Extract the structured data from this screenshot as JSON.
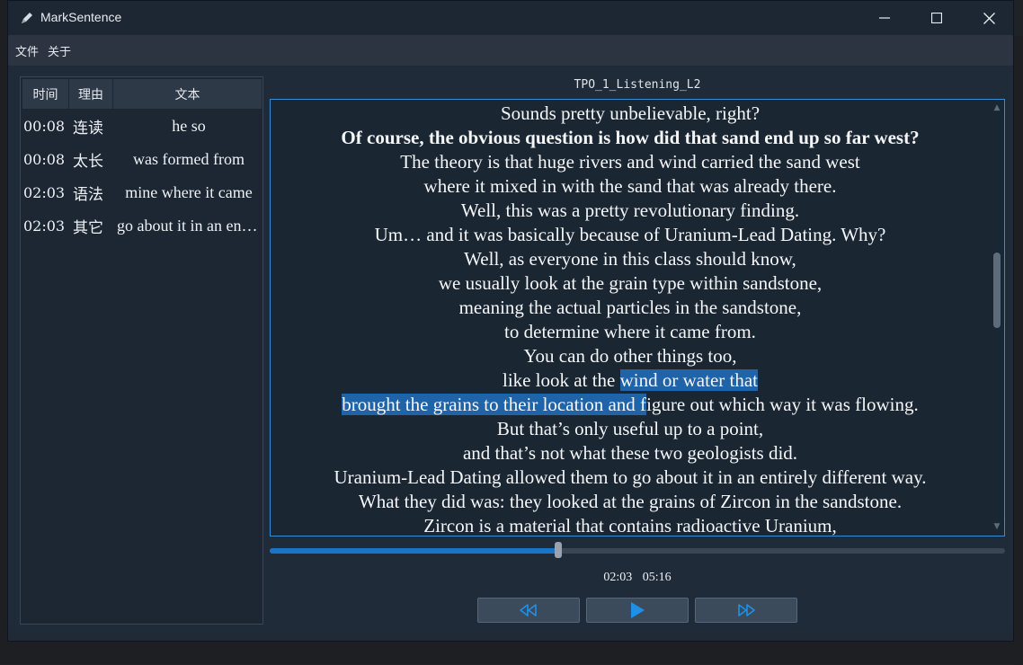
{
  "window": {
    "title": "MarkSentence"
  },
  "menu": [
    {
      "label": "文件"
    },
    {
      "label": "关于"
    }
  ],
  "table": {
    "headers": {
      "time": "时间",
      "reason": "理由",
      "text": "文本"
    },
    "rows": [
      {
        "time": "00:08",
        "reason": "连读",
        "text": "he so"
      },
      {
        "time": "00:08",
        "reason": "太长",
        "text": "was formed from"
      },
      {
        "time": "02:03",
        "reason": "语法",
        "text": "mine where it came"
      },
      {
        "time": "02:03",
        "reason": "其它",
        "text": "go about it in an entirely"
      }
    ]
  },
  "file_label": "TPO_1_Listening_L2",
  "transcript": {
    "lines": [
      {
        "text": "Sounds pretty unbelievable, right?"
      },
      {
        "text": "Of course, the obvious question is how did that sand end up so far west?"
      },
      {
        "text": "The theory is that huge rivers and wind carried the sand west"
      },
      {
        "text": "where it mixed in with the sand that was already there."
      },
      {
        "text": "Well, this was a pretty revolutionary finding."
      },
      {
        "text": "Um… and it was basically because of Uranium-Lead Dating. Why?"
      },
      {
        "text": "Well, as everyone in this class should know,"
      },
      {
        "text": "we usually look at the grain type within sandstone,"
      },
      {
        "text": "meaning the actual particles in the sandstone,"
      },
      {
        "text": "to determine where it came from."
      },
      {
        "text": "You can do other things too,"
      },
      {
        "pre": "like look at the ",
        "hl": "wind or water that ",
        "post": ""
      },
      {
        "pre": "",
        "hl": "brought the grains to their location and f",
        "post": "igure out which way it was flowing."
      },
      {
        "text": "But that’s only useful up to a point,"
      },
      {
        "text": "and that’s not what these two geologists did."
      },
      {
        "text": "Uranium-Lead Dating allowed them to go about it in an entirely different way."
      },
      {
        "text": "What they did was: they looked at the grains of Zircon in the sandstone."
      },
      {
        "text": "Zircon is a material that contains radioactive Uranium,"
      }
    ]
  },
  "player": {
    "current_time": "02:03",
    "total_time": "05:16",
    "progress": 0.393
  },
  "colors": {
    "accent": "#1d73c4",
    "highlight": "#1f63a8",
    "play_icon": "#1e90e6"
  },
  "icons": {
    "app": "pen-icon",
    "back": "rewind-icon",
    "play": "play-icon",
    "forward": "fast-forward-icon"
  }
}
